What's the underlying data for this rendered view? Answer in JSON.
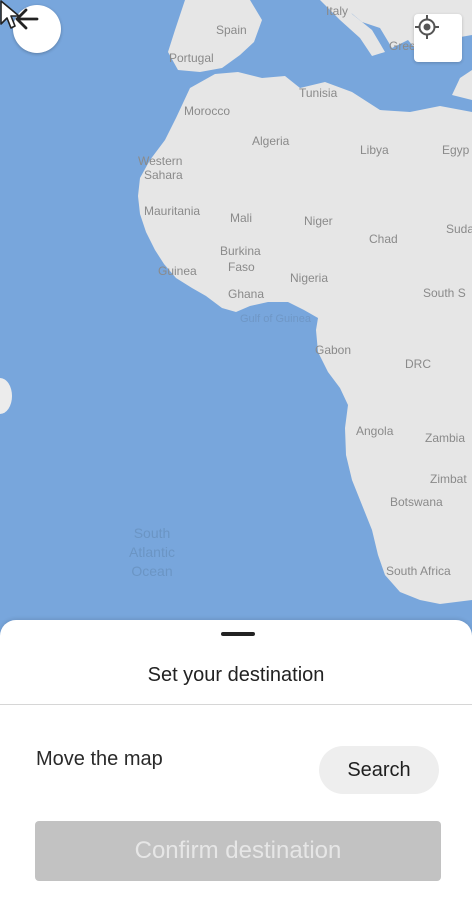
{
  "map": {
    "labels": {
      "spain": "Spain",
      "italy": "Italy",
      "portugal": "Portugal",
      "greece": "Gree",
      "tunisia": "Tunisia",
      "morocco": "Morocco",
      "algeria": "Algeria",
      "libya": "Libya",
      "egypt": "Egyp",
      "western_sahara_1": "Western",
      "western_sahara_2": "Sahara",
      "mauritania": "Mauritania",
      "mali": "Mali",
      "niger": "Niger",
      "chad": "Chad",
      "sudan": "Suda",
      "burkina_1": "Burkina",
      "burkina_2": "Faso",
      "guinea": "Guinea",
      "nigeria": "Nigeria",
      "ghana": "Ghana",
      "south_sudan": "South S",
      "gulf_of_guinea": "Gulf of Guinea",
      "gabon": "Gabon",
      "drc": "DRC",
      "angola": "Angola",
      "zambia": "Zambia",
      "zimbabwe": "Zimbat",
      "botswana": "Botswana",
      "south_africa": "South Africa",
      "ocean_1": "South",
      "ocean_2": "Atlantic",
      "ocean_3": "Ocean"
    },
    "colors": {
      "water": "#78a6dc",
      "land": "#e6e6e6"
    }
  },
  "controls": {
    "back_icon": "arrow-left-icon",
    "locate_icon": "my-location-icon"
  },
  "sheet": {
    "title": "Set your destination",
    "hint": "Move the map",
    "search_label": "Search",
    "confirm_label": "Confirm destination"
  }
}
